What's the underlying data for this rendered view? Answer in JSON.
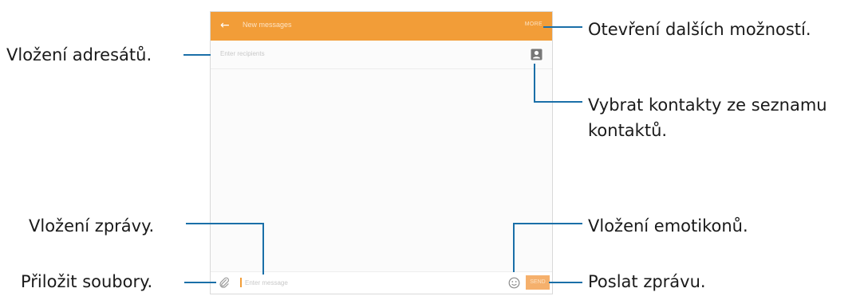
{
  "screen": {
    "appbar": {
      "back_icon": "back-arrow-icon",
      "title": "New messages",
      "more_label": "MORE"
    },
    "recipients": {
      "placeholder": "Enter recipients",
      "contact_icon": "contact-book-icon"
    },
    "compose": {
      "attach_icon": "paperclip-icon",
      "placeholder": "Enter message",
      "emoji_icon": "smiley-icon",
      "send_label": "SEND"
    },
    "colors": {
      "accent": "#f29d38",
      "send_button": "#f5b06c",
      "callout_line": "#1a6fa8"
    }
  },
  "callouts": {
    "more_options": "Otevření dalších možností.",
    "insert_recipients": "Vložení adresátů.",
    "select_contacts_line1": "Vybrat kontakty ze seznamu",
    "select_contacts_line2": "kontaktů.",
    "enter_message": "Vložení zprávy.",
    "insert_emoticons": "Vložení emotikonů.",
    "attach_files": "Přiložit soubory.",
    "send_message": "Poslat zprávu."
  }
}
